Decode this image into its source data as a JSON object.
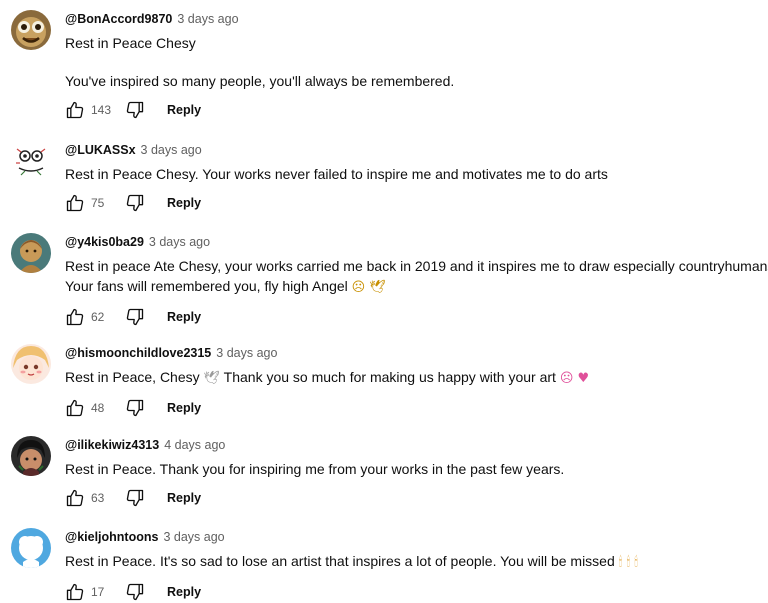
{
  "comments": [
    {
      "handle": "@BonAccord9870",
      "time": "3 days ago",
      "line1": "Rest in Peace Chesy",
      "line2": "You've inspired so many people, you'll always be remembered.",
      "likes": "143",
      "reply": "Reply"
    },
    {
      "handle": "@LUKASSx",
      "time": "3 days ago",
      "line1": "Rest in Peace Chesy. Your works never failed to inspire me and motivates me to do arts",
      "likes": "75",
      "reply": "Reply"
    },
    {
      "handle": "@y4kis0ba29",
      "time": "3 days ago",
      "line1": "Rest in peace Ate Chesy, your works carried me back in 2019 and it inspires me to draw especially countryhumans",
      "line2": "Your fans will remembered you, fly high Angel",
      "line2_emoji": "☹ 🕊",
      "likes": "62",
      "reply": "Reply"
    },
    {
      "handle": "@hismoonchildlove2315",
      "time": "3 days ago",
      "line1a": "Rest in Peace, Chesy",
      "line1a_emoji": "🕊",
      "line1b": "Thank you so much for making us happy with your art",
      "line1b_emoji": "☹ ♥",
      "likes": "48",
      "reply": "Reply"
    },
    {
      "handle": "@ilikekiwiz4313",
      "time": "4 days ago",
      "line1": "Rest in Peace. Thank you for inspiring me from your works in the past few years.",
      "likes": "63",
      "reply": "Reply"
    },
    {
      "handle": "@kieljohntoons",
      "time": "3 days ago",
      "line1": "Rest in Peace. It's so sad to lose an artist that inspires a lot of people. You will be missed",
      "line1_emoji": "🕯 🕯 🕯",
      "likes": "17",
      "reply": "Reply"
    }
  ],
  "colors": {
    "text": "#0f0f0f",
    "secondary": "#606060",
    "heart": "#ff5a9a",
    "sad": "#f5b400"
  }
}
